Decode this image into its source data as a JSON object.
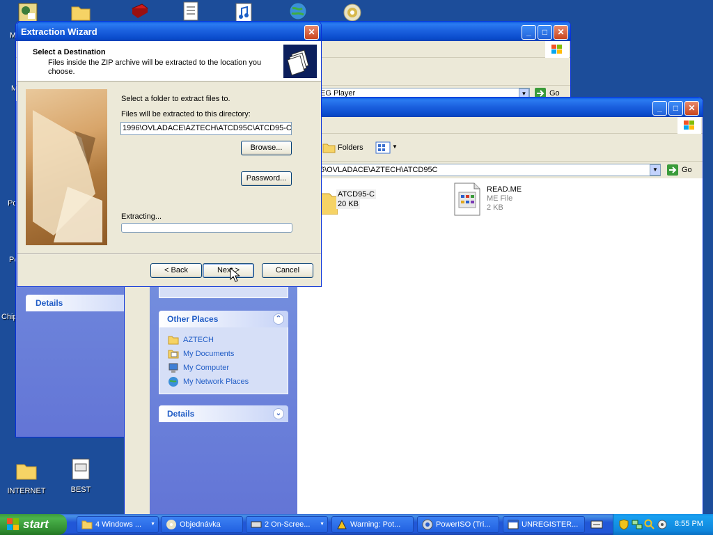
{
  "desktop": {
    "icons": [
      {
        "label": "INTERNET"
      },
      {
        "label": "BEST"
      }
    ],
    "edge_labels": [
      "M",
      "M",
      "Pc",
      "Pc",
      "Chip"
    ]
  },
  "back_window": {
    "address_value": "EG Player",
    "go_label": "Go",
    "details_label": "Details"
  },
  "explorer": {
    "folders_label": "Folders",
    "address_value": "6\\OVLADACE\\AZTECH\\ATCD95C",
    "go_label": "Go",
    "files": [
      {
        "name": "ATCD95-C",
        "type": "",
        "size": "20 KB"
      },
      {
        "name": "READ.ME",
        "type": "ME File",
        "size": "2 KB"
      }
    ],
    "other_places": {
      "title": "Other Places",
      "items": [
        "AZTECH",
        "My Documents",
        "My Computer",
        "My Network Places"
      ]
    },
    "details_title": "Details"
  },
  "wizard": {
    "title": "Extraction Wizard",
    "header_title": "Select a Destination",
    "header_desc": "Files inside the ZIP archive will be extracted to the location you choose.",
    "select_label": "Select a folder to extract files to.",
    "dir_label": "Files will be extracted to this directory:",
    "dir_value": "1996\\OVLADACE\\AZTECH\\ATCD95C\\ATCD95-C",
    "browse_label": "Browse...",
    "password_label": "Password...",
    "extracting_label": "Extracting...",
    "progress": 0,
    "back_label": "< Back",
    "next_label": "Next >",
    "cancel_label": "Cancel"
  },
  "taskbar": {
    "start_label": "start",
    "tasks": [
      {
        "label": "4 Windows ..."
      },
      {
        "label": "Objednávka"
      },
      {
        "label": "2 On-Scree..."
      },
      {
        "label": "Warning: Pot..."
      },
      {
        "label": "PowerISO (Tri..."
      },
      {
        "label": "UNREGISTER..."
      }
    ],
    "clock": "8:55 PM"
  },
  "colors": {
    "desktop": "#1c4d9a",
    "title_blue": "#0a4ccc",
    "start_green": "#3c9b3c",
    "link_blue": "#215dc6"
  }
}
